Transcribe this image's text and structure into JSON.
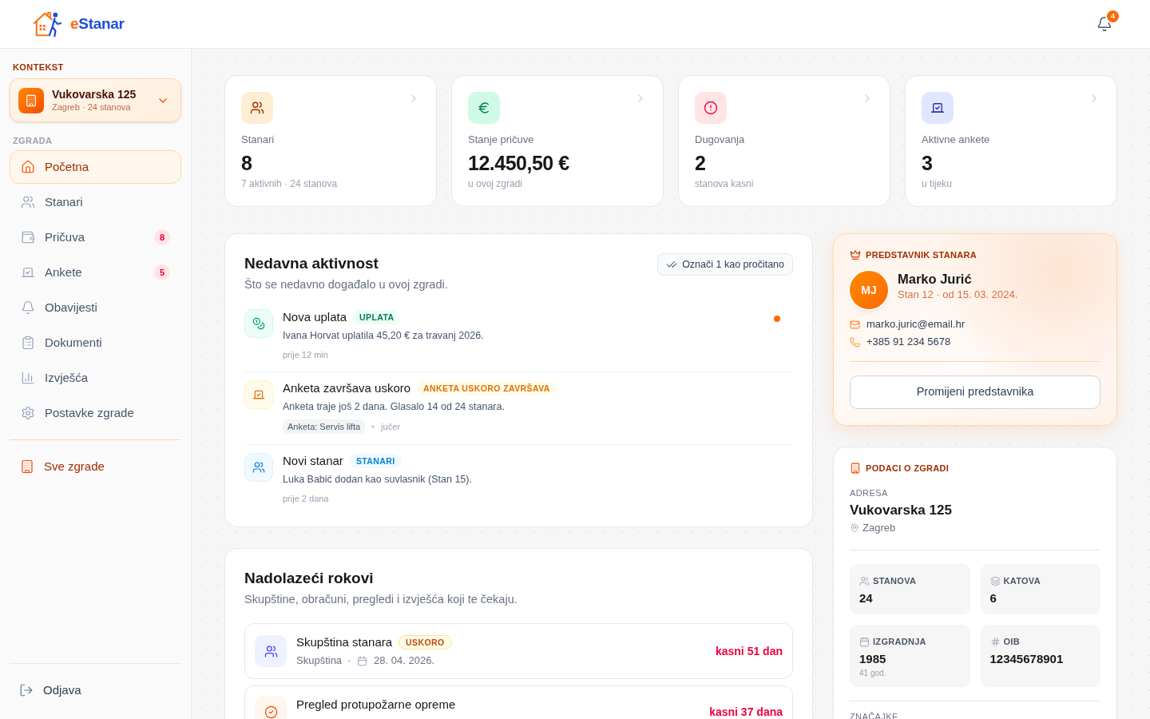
{
  "header": {
    "logo": {
      "accent": "e",
      "name": "Stanar"
    },
    "notifications": {
      "count": "4"
    }
  },
  "sidebar": {
    "context_label": "KONTEKST",
    "context": {
      "title": "Vukovarska 125",
      "subtitle": "Zagreb · 24 stanova"
    },
    "section_label": "ZGRADA",
    "items": [
      {
        "label": "Početna",
        "selected": true
      },
      {
        "label": "Stanari",
        "selected": false
      },
      {
        "label": "Pričuva",
        "selected": false,
        "badge": "8"
      },
      {
        "label": "Ankete",
        "selected": false,
        "badge": "5"
      },
      {
        "label": "Obavijesti",
        "selected": false
      },
      {
        "label": "Dokumenti",
        "selected": false
      },
      {
        "label": "Izvješća",
        "selected": false
      },
      {
        "label": "Postavke zgrade",
        "selected": false
      }
    ],
    "all_buildings": "Sve zgrade",
    "logout": "Odjava"
  },
  "stats": [
    {
      "label": "Stanari",
      "value": "8",
      "note": "7 aktivnih · 24 stanova"
    },
    {
      "label": "Stanje pričuve",
      "value": "12.450,50 €",
      "note": "u ovoj zgradi"
    },
    {
      "label": "Dugovanja",
      "value": "2",
      "note": "stanova kasni"
    },
    {
      "label": "Aktivne ankete",
      "value": "3",
      "note": "u tijeku"
    }
  ],
  "activity": {
    "title": "Nedavna aktivnost",
    "subtitle": "Što se nedavno događalo u ovoj zgradi.",
    "mark_read": "Označi 1 kao pročitano",
    "items": [
      {
        "title": "Nova uplata",
        "badge": "UPLATA",
        "text": "Ivana Horvat uplatila 45,20 € za travanj 2026.",
        "time": "prije 12 min",
        "unread": true
      },
      {
        "title": "Anketa završava uskoro",
        "badge": "ANKETA USKORO ZAVRŠAVA",
        "text": "Anketa traje još 2 dana. Glasalo 14 od 24 stanara.",
        "tag": "Anketa: Servis lifta",
        "time": "jučer",
        "unread": false
      },
      {
        "title": "Novi stanar",
        "badge": "STANARI",
        "text": "Luka Babić dodan kao suvlasnik (Stan 15).",
        "time": "prije 2 dana",
        "unread": false
      }
    ]
  },
  "deadlines": {
    "title": "Nadolazeći rokovi",
    "subtitle": "Skupštine, obračuni, pregledi i izvješća koji te čekaju.",
    "items": [
      {
        "title": "Skupština stanara",
        "badge": "USKORO",
        "category": "Skupština",
        "date": "28. 04. 2026.",
        "status": "kasni 51 dan"
      },
      {
        "title": "Pregled protupožarne opreme",
        "status": "kasni 37 dana"
      }
    ]
  },
  "representative": {
    "heading": "PREDSTAVNIK STANARA",
    "initials": "MJ",
    "name": "Marko Jurić",
    "detail": "Stan 12 · od 15. 03. 2024.",
    "email": "marko.juric@email.hr",
    "phone": "+385 91 234 5678",
    "button": "Promijeni predstavnika"
  },
  "building": {
    "heading": "PODACI O ZGRADI",
    "address_label": "ADRESA",
    "address": "Vukovarska 125",
    "city": "Zagreb",
    "facts": [
      {
        "label": "STANOVA",
        "value": "24"
      },
      {
        "label": "KATOVA",
        "value": "6"
      },
      {
        "label": "IZGRADNJA",
        "value": "1985",
        "note": "41 god."
      },
      {
        "label": "OIB",
        "value": "12345678901"
      }
    ],
    "section_label": "ZNAČAJKE"
  }
}
